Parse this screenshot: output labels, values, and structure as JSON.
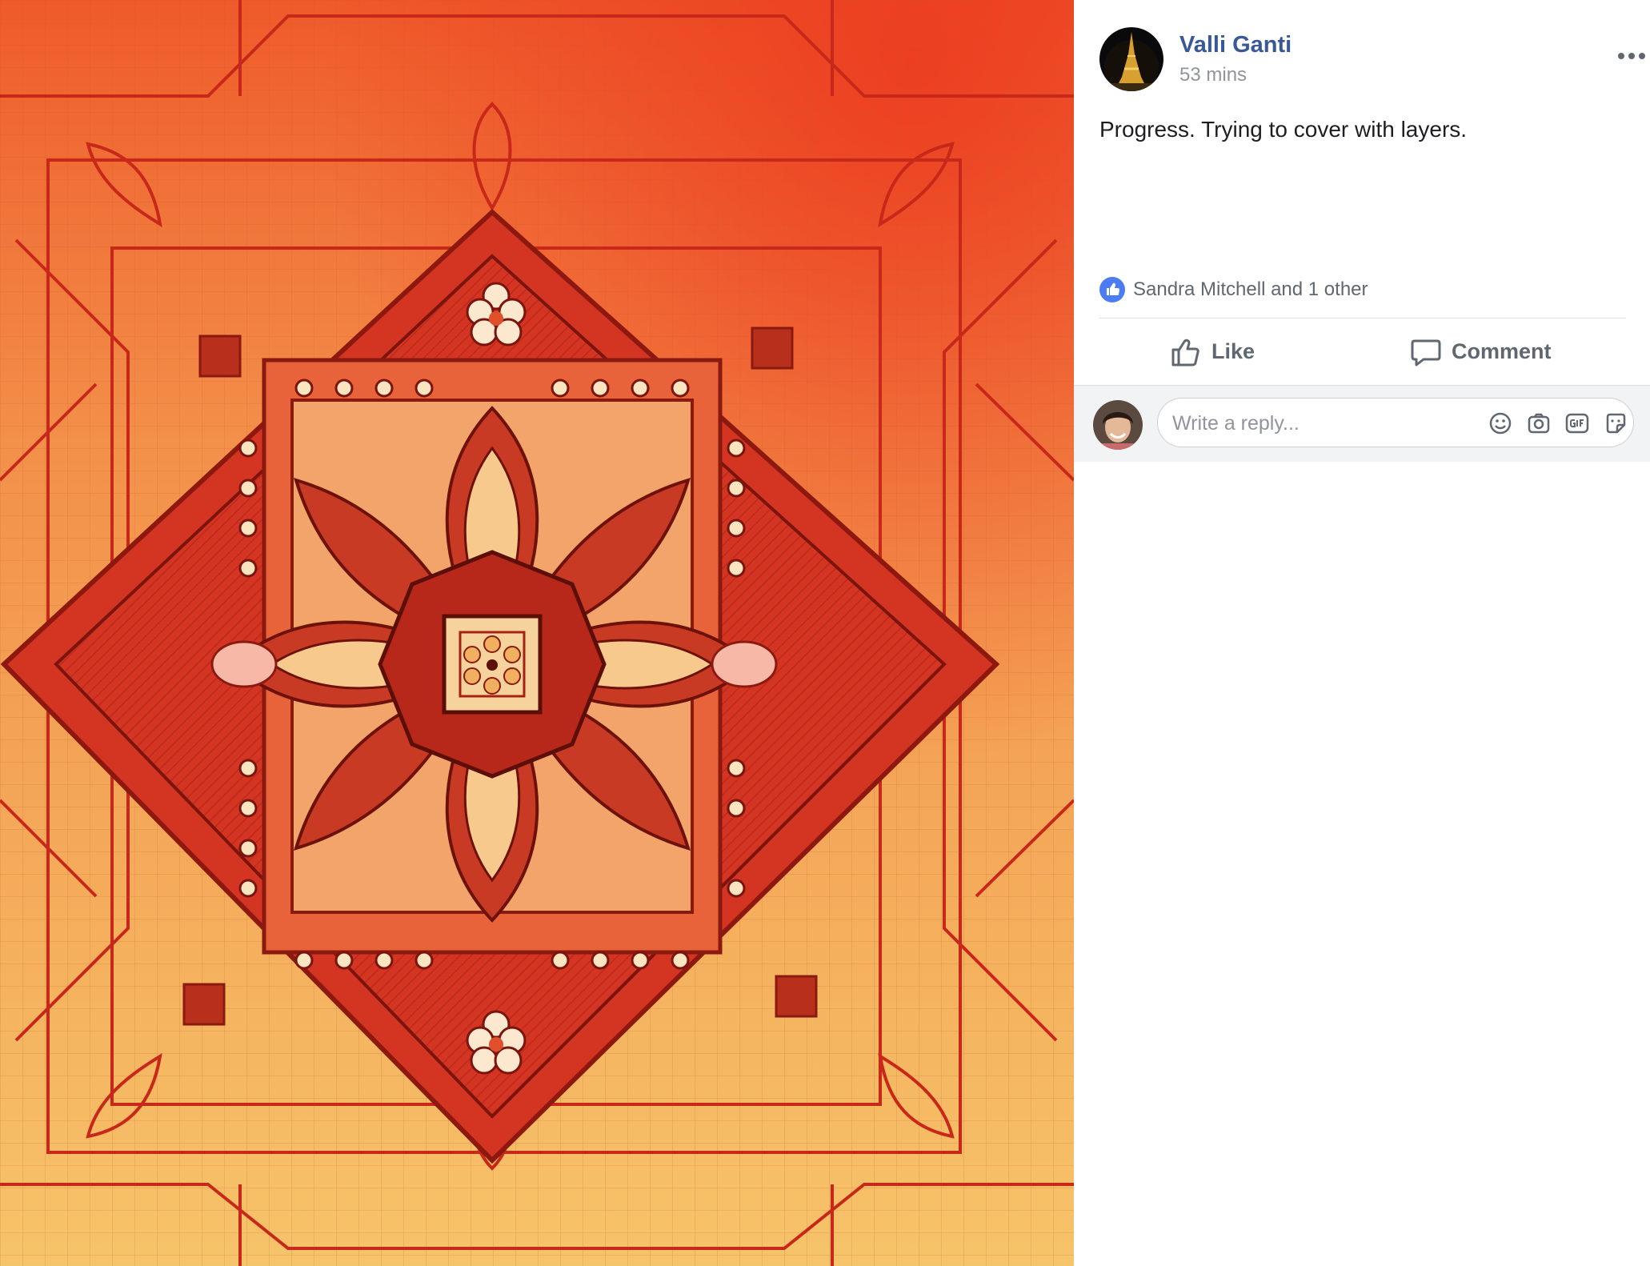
{
  "post": {
    "author": "Valli Ganti",
    "timestamp": "53 mins",
    "text": "Progress. Trying to cover with layers.",
    "options_icon": "more-horizontal-icon"
  },
  "reactions": {
    "icon": "like-reaction-icon",
    "summary": "Sandra Mitchell and 1 other"
  },
  "actions": {
    "like_label": "Like",
    "like_icon": "thumbs-up-icon",
    "comment_label": "Comment",
    "comment_icon": "speech-bubble-icon"
  },
  "reply": {
    "placeholder": "Write a reply...",
    "icons": [
      "emoji-icon",
      "camera-icon",
      "gif-icon",
      "sticker-icon"
    ]
  },
  "colors": {
    "author_link": "#385898",
    "like_badge": "#4c7cf3",
    "secondary_text": "#606770"
  }
}
